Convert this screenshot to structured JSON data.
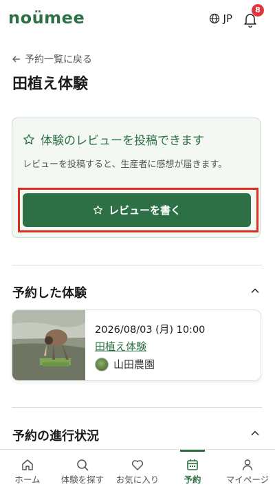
{
  "header": {
    "logo": "noümee",
    "lang": "JP",
    "notification_count": "8"
  },
  "page": {
    "back_link": "予約一覧に戻る",
    "title": "田植え体験"
  },
  "review_prompt": {
    "heading": "体験のレビューを投稿できます",
    "description": "レビューを投稿すると、生産者に感想が届きます。",
    "button_label": "レビューを書く"
  },
  "booked_section": {
    "title": "予約した体験",
    "booking": {
      "datetime": "2026/08/03 (月) 10:00",
      "experience_name": "田植え体験",
      "farm_name": "山田農園"
    }
  },
  "progress_section": {
    "title": "予約の進行状況"
  },
  "bottom_nav": [
    {
      "label": "ホーム",
      "icon": "home-icon",
      "active": false
    },
    {
      "label": "体験を探す",
      "icon": "search-icon",
      "active": false
    },
    {
      "label": "お気に入り",
      "icon": "heart-icon",
      "active": false
    },
    {
      "label": "予約",
      "icon": "calendar-icon",
      "active": true
    },
    {
      "label": "マイページ",
      "icon": "user-icon",
      "active": false
    }
  ],
  "colors": {
    "brand_green": "#2e7044",
    "badge_red": "#e0373f",
    "highlight_red": "#e02b1f"
  }
}
